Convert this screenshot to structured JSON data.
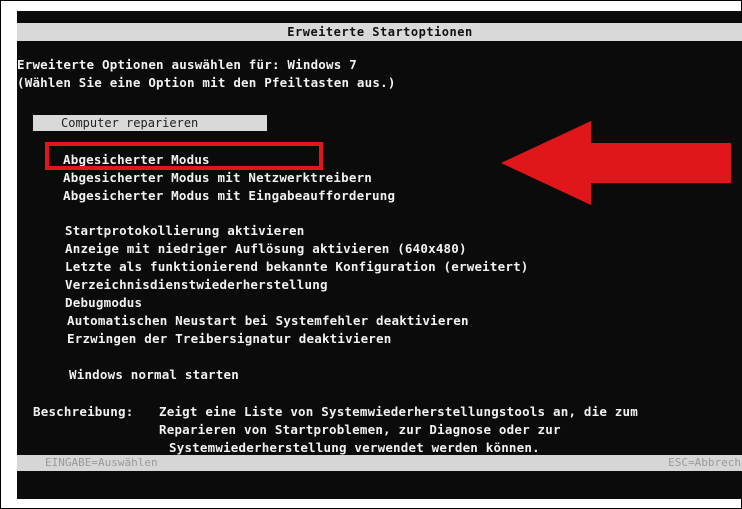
{
  "title": "Erweiterte Startoptionen",
  "intro": [
    "Erweiterte Optionen auswählen für: Windows 7",
    "(Wählen Sie eine Option mit den Pfeiltasten aus.)"
  ],
  "selected_option": "Computer reparieren",
  "safe_modes": [
    "Abgesicherter Modus",
    "Abgesicherter Modus mit Netzwerktreibern",
    "Abgesicherter Modus mit Eingabeaufforderung"
  ],
  "other_options": [
    "Startprotokollierung aktivieren",
    "Anzeige mit niedriger Auflösung aktivieren (640x480)",
    "Letzte als funktionierend bekannte Konfiguration (erweitert)",
    "Verzeichnisdienstwiederherstellung",
    "Debugmodus",
    "Automatischen Neustart bei Systemfehler deaktivieren",
    "Erzwingen der Treibersignatur deaktivieren"
  ],
  "normal_start": "Windows normal starten",
  "description": {
    "label": "Beschreibung:",
    "lines": [
      "Zeigt eine Liste von Systemwiederherstellungstools an, die zum",
      "Reparieren von Startproblemen, zur Diagnose oder zur",
      "Systemwiederherstellung verwendet werden können."
    ]
  },
  "footer": {
    "left": "EINGABE=Auswählen",
    "right": "ESC=Abbrech"
  },
  "colors": {
    "highlight_box": "#e0161b",
    "arrow": "#e0161b",
    "background": "#0b0b0b",
    "bar": "#d9d9d9"
  }
}
